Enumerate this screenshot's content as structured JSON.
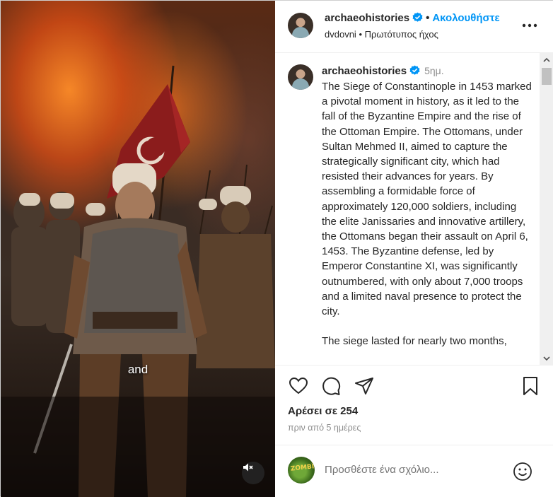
{
  "header": {
    "username": "archaeohistories",
    "separator": "•",
    "follow_label": "Ακολουθήστε",
    "audio_author": "dvdovni",
    "audio_separator": "•",
    "audio_label": "Πρωτότυπος ήχος"
  },
  "video": {
    "caption": "and",
    "mute_icon": "speaker-muted-icon"
  },
  "post": {
    "username": "archaeohistories",
    "time": "5ημ.",
    "caption": "The Siege of Constantinople in 1453 marked a pivotal moment in history, as it led to the fall of the Byzantine Empire and the rise of the Ottoman Empire. The Ottomans, under Sultan Mehmed II, aimed to capture the strategically significant city, which had resisted their advances for years. By assembling a formidable force of approximately 120,000 soldiers, including the elite Janissaries and innovative artillery, the Ottomans began their assault on April 6, 1453. The Byzantine defense, led by Emperor Constantine XI, was significantly outnumbered, with only about 7,000 troops and a limited naval presence to protect the city.\n\nThe siege lasted for nearly two months,"
  },
  "stats": {
    "likes": "Αρέσει σε 254",
    "posted_ago": "πριν από 5 ημέρες"
  },
  "comment_box": {
    "placeholder": "Προσθέστε ένα σχόλιο...",
    "avatar_text": "ZOMBÎ"
  },
  "colors": {
    "accent": "#0095f6",
    "verified": "#0095f6",
    "text": "#262626",
    "secondary_text": "#8e8e8e",
    "banner_red": "#8b1c1c"
  }
}
